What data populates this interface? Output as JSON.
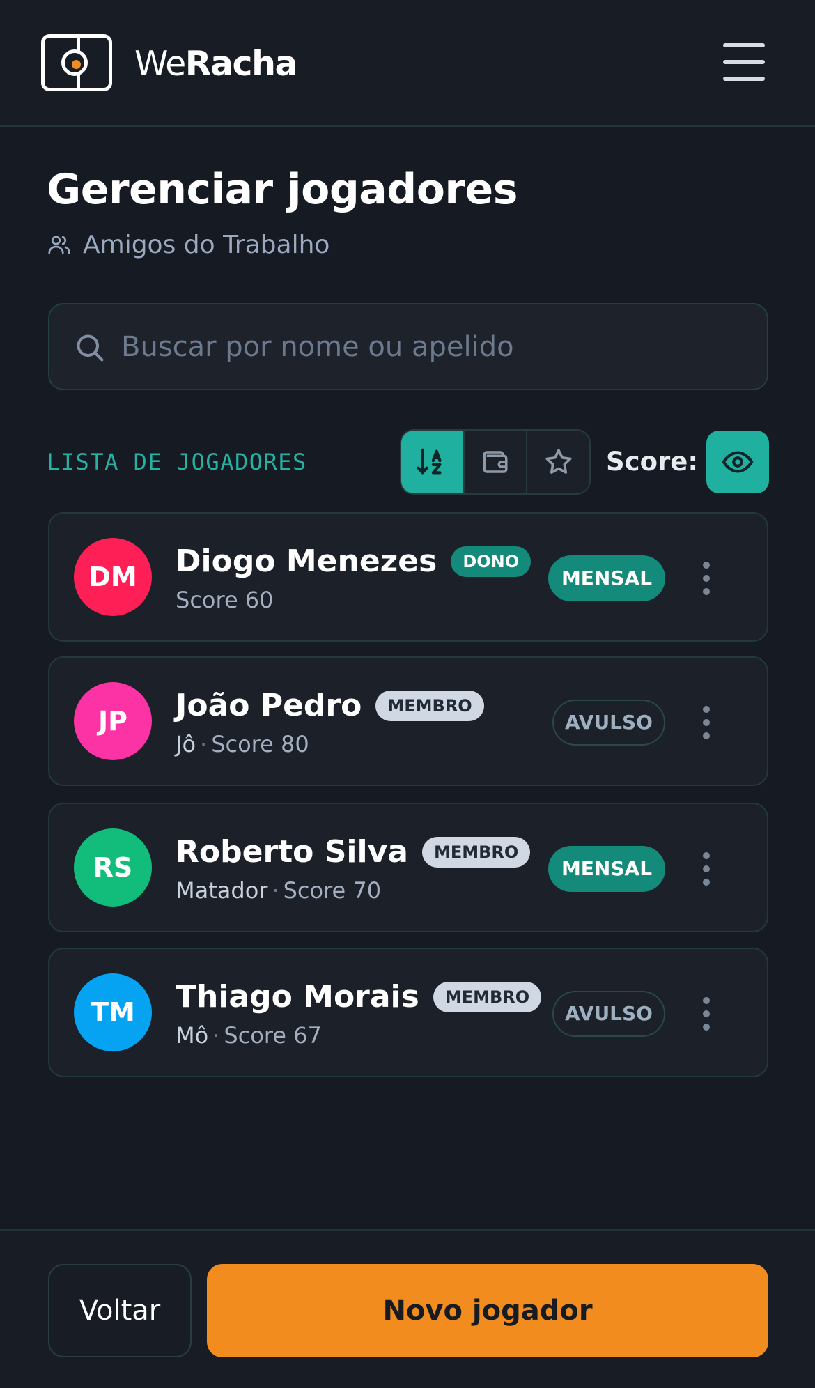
{
  "header": {
    "brand_prefix": "We",
    "brand_suffix": "Racha",
    "logo_icon": "soccer-field-icon",
    "menu_icon": "hamburger-menu-icon"
  },
  "page": {
    "title": "Gerenciar jogadores",
    "group_icon": "users-icon",
    "group_name": "Amigos do Trabalho"
  },
  "search": {
    "icon": "search-icon",
    "placeholder": "Buscar por nome ou apelido",
    "value": ""
  },
  "list": {
    "label": "LISTA DE JOGADORES",
    "sort_options": [
      {
        "icon": "sort-alpha-icon",
        "active": true
      },
      {
        "icon": "wallet-icon",
        "active": false
      },
      {
        "icon": "star-icon",
        "active": false
      }
    ],
    "score_label": "Score:",
    "score_toggle_icon": "eye-icon"
  },
  "players": [
    {
      "initials": "DM",
      "name": "Diogo Menezes",
      "role": "DONO",
      "nickname": "",
      "sep": "",
      "score": "Score 60",
      "plan": "MENSAL",
      "avatar_color": "#ff1f57"
    },
    {
      "initials": "JP",
      "name": "João Pedro",
      "role": "MEMBRO",
      "nickname": "Jô",
      "sep": "·",
      "score": "Score 80",
      "plan": "AVULSO",
      "avatar_color": "#fb33a5"
    },
    {
      "initials": "RS",
      "name": "Roberto Silva",
      "role": "MEMBRO",
      "nickname": "Matador",
      "sep": "·",
      "score": "Score 70",
      "plan": "MENSAL",
      "avatar_color": "#12bd7b"
    },
    {
      "initials": "TM",
      "name": "Thiago Morais",
      "role": "MEMBRO",
      "nickname": "Mô",
      "sep": "·",
      "score": "Score 67",
      "plan": "AVULSO",
      "avatar_color": "#05a3f2"
    }
  ],
  "footer": {
    "back_label": "Voltar",
    "new_label": "Novo jogador"
  },
  "colors": {
    "accent": "#1fb09f",
    "primary_button": "#f28c1e",
    "background": "#161a22"
  }
}
